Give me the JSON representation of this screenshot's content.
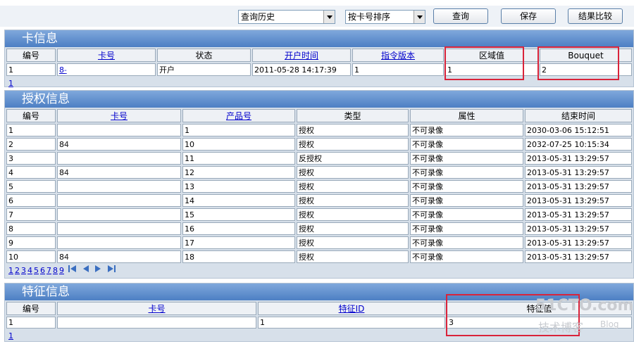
{
  "toolbar": {
    "history_select": "查询历史",
    "sort_select": "按卡号排序",
    "query_button": "查询",
    "save_button": "保存",
    "compare_button": "结果比较"
  },
  "card_info": {
    "title": "卡信息",
    "headers": [
      "编号",
      "卡号",
      "状态",
      "开户时间",
      "指令版本",
      "区域值",
      "Bouquet"
    ],
    "row": [
      "1",
      "8-",
      "开户",
      "2011-05-28 14:17:39",
      "1",
      "1",
      "2"
    ],
    "page": "1"
  },
  "auth_info": {
    "title": "授权信息",
    "headers": [
      "编号",
      "卡号",
      "产品号",
      "类型",
      "属性",
      "结束时间"
    ],
    "rows": [
      [
        "1",
        "",
        "1",
        "授权",
        "不可录像",
        "2030-03-06 15:12:51"
      ],
      [
        "2",
        "84",
        "10",
        "授权",
        "不可录像",
        "2032-07-25 10:15:34"
      ],
      [
        "3",
        "",
        "11",
        "反授权",
        "不可录像",
        "2013-05-31 13:29:57"
      ],
      [
        "4",
        "84",
        "12",
        "授权",
        "不可录像",
        "2013-05-31 13:29:57"
      ],
      [
        "5",
        "",
        "13",
        "授权",
        "不可录像",
        "2013-05-31 13:29:57"
      ],
      [
        "6",
        "",
        "14",
        "授权",
        "不可录像",
        "2013-05-31 13:29:57"
      ],
      [
        "7",
        "",
        "15",
        "授权",
        "不可录像",
        "2013-05-31 13:29:57"
      ],
      [
        "8",
        "",
        "16",
        "授权",
        "不可录像",
        "2013-05-31 13:29:57"
      ],
      [
        "9",
        "",
        "17",
        "授权",
        "不可录像",
        "2013-05-31 13:29:57"
      ],
      [
        "10",
        "84",
        "18",
        "授权",
        "不可录像",
        "2013-05-31 13:29:57"
      ]
    ],
    "pages": [
      "1",
      "2",
      "3",
      "4",
      "5",
      "6",
      "7",
      "8",
      "9"
    ]
  },
  "feature_info": {
    "title": "特征信息",
    "headers": [
      "编号",
      "卡号",
      "特征ID",
      "特征值"
    ],
    "row": [
      "1",
      "",
      "1",
      "3"
    ],
    "page": "1"
  },
  "watermark": {
    "line1": "51CTO.com",
    "line2": "技术博客",
    "line3": "Blog"
  }
}
